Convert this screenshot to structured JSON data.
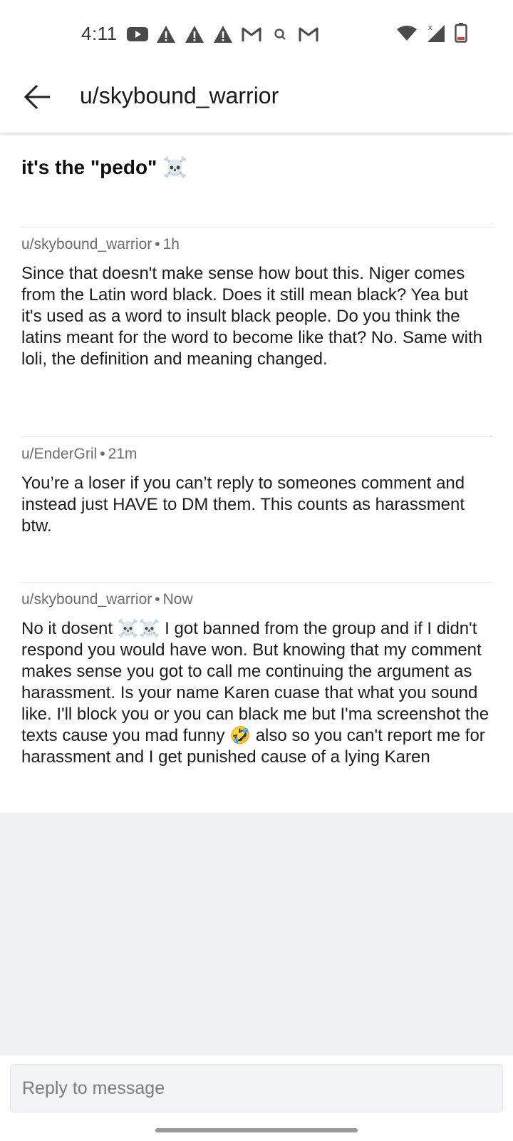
{
  "status_bar": {
    "time": "4:11",
    "left_icons": [
      "youtube-icon",
      "warning-icon",
      "warning-icon",
      "warning-icon",
      "gmail-icon",
      "search-icon",
      "gmail-icon"
    ],
    "right_icons": [
      "wifi-icon",
      "cell-signal-icon",
      "battery-icon"
    ]
  },
  "header": {
    "title": "u/skybound_warrior"
  },
  "thread": {
    "subject": "it's the \"pedo\" ☠️",
    "messages": [
      {
        "author": "u/skybound_warrior",
        "time": "1h",
        "body": "Since that doesn't make sense how bout this. Niger comes from the Latin word black. Does it still mean black? Yea but it's used as a word to insult black people. Do you think the latins meant for the word to become like that? No. Same with loli, the definition and meaning changed."
      },
      {
        "author": "u/EnderGril",
        "time": "21m",
        "body": "You’re a loser if you can’t reply to someones comment and instead just HAVE to DM them. This counts as harassment btw."
      },
      {
        "author": "u/skybound_warrior",
        "time": "Now",
        "body": "No it dosent ☠️☠️ I got banned from the group and if I didn't respond you would have won. But knowing that my comment makes sense you got to call me continuing the argument as harassment. Is your name Karen cuase that what you sound like. I'll block you or you can black me but I'ma screenshot the texts cause you mad funny 🤣 also so you can't report me for harassment and I get punished cause of a lying Karen"
      }
    ]
  },
  "reply": {
    "placeholder": "Reply to message"
  },
  "meta_separator": "•"
}
